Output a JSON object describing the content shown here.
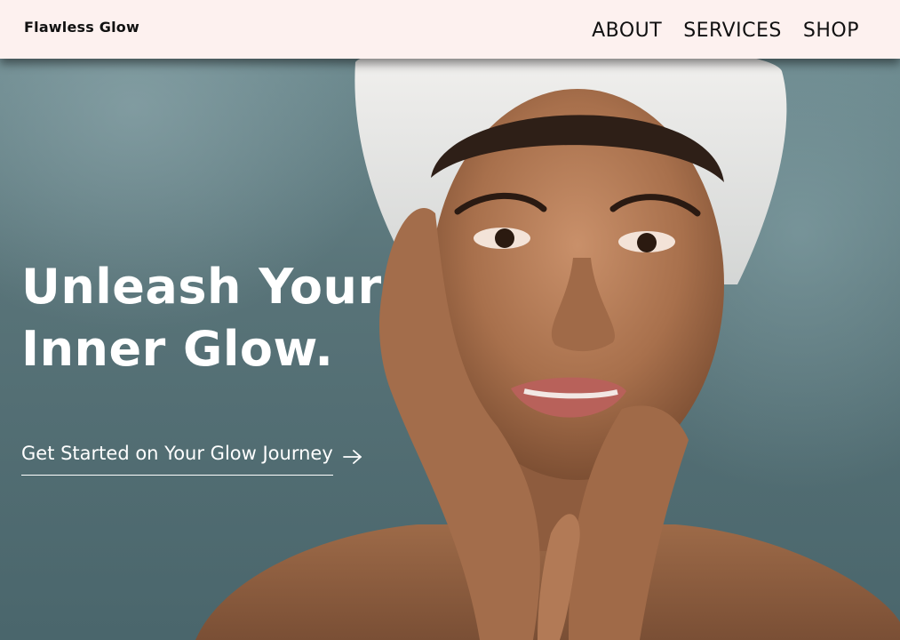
{
  "header": {
    "logo": "Flawless Glow",
    "nav": [
      {
        "label": "ABOUT"
      },
      {
        "label": "SERVICES"
      },
      {
        "label": "SHOP"
      }
    ]
  },
  "hero": {
    "headline_line1": "Unleash Your",
    "headline_line2": "Inner Glow.",
    "cta_label": "Get Started on Your Glow Journey",
    "cta_icon": "arrow-right-icon",
    "image": "portrait-photo"
  },
  "colors": {
    "header_bg": "#fdf1ef",
    "background_teal": "#587378",
    "text_light": "#ffffff",
    "text_dark": "#111111"
  }
}
